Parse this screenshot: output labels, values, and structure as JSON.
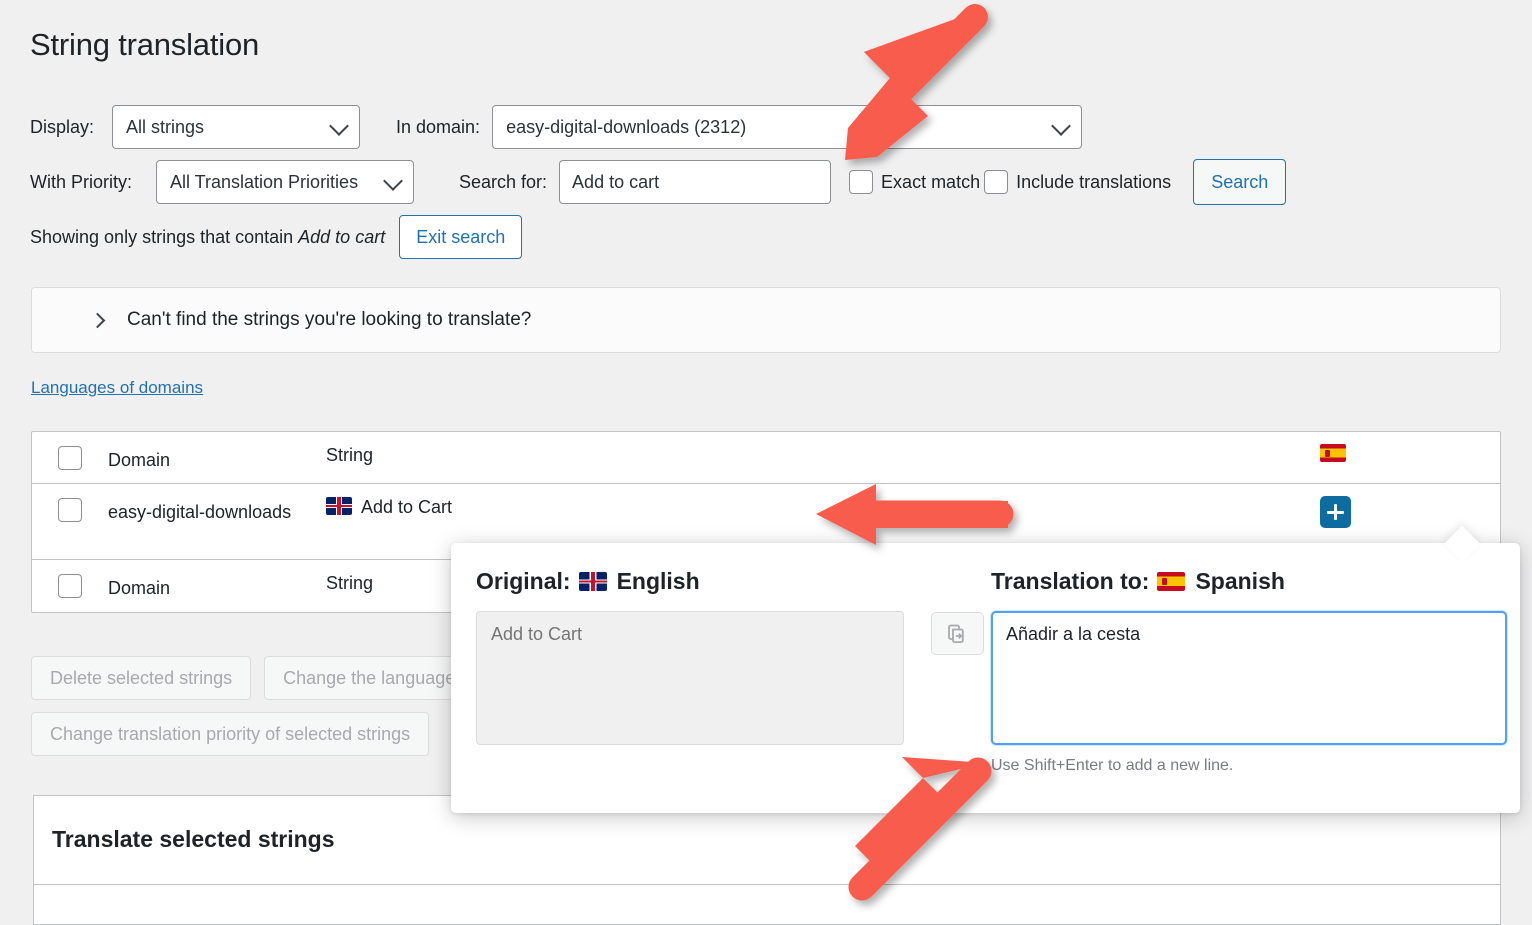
{
  "page": {
    "title": "String translation"
  },
  "filters": {
    "display_label": "Display:",
    "display_value": "All strings",
    "domain_label": "In domain:",
    "domain_value": "easy-digital-downloads (2312)",
    "priority_label": "With Priority:",
    "priority_value": "All Translation Priorities",
    "search_label": "Search for:",
    "search_value": "Add to cart",
    "search_placeholder": "Search for:",
    "exact_match_label": "Exact match",
    "include_translations_label": "Include translations",
    "search_button": "Search"
  },
  "showing": {
    "prefix": "Showing only strings that contain ",
    "term": "Add to cart",
    "exit_button": "Exit search"
  },
  "accordion": {
    "label": "Can't find the strings you're looking to translate?",
    "icon": "chevron-right-icon"
  },
  "languages_link": "Languages of domains",
  "table": {
    "headers": {
      "domain": "Domain",
      "string": "String",
      "language_flag": "spain-flag-icon"
    },
    "rows": [
      {
        "domain": "easy-digital-downloads",
        "string": "Add to Cart",
        "string_flag": "uk-flag-icon",
        "action": "add-translation-icon"
      }
    ],
    "footer_headers": {
      "domain": "Domain",
      "string": "String"
    }
  },
  "bulk_actions": {
    "delete": "Delete selected strings",
    "change_language": "Change the language of selected strings",
    "change_priority": "Change translation priority of selected strings"
  },
  "translate_panel": {
    "title": "Translate selected strings"
  },
  "popup": {
    "original_label": "Original:",
    "original_language": "English",
    "original_flag": "uk-flag-icon",
    "original_placeholder": "Add to Cart",
    "copy_icon": "copy-to-icon",
    "translation_label": "Translation to:",
    "translation_language": "Spanish",
    "translation_flag": "spain-flag-icon",
    "translation_value": "Añadir a la cesta",
    "hint": "Use Shift+Enter to add a new line."
  },
  "colors": {
    "accent_blue": "#2271b1",
    "plus_button_blue": "#0e6ca1",
    "arrow_red": "#f85c4e",
    "focus_blue": "#4fa2f3",
    "page_bg": "#f0f0f1"
  },
  "annotations": [
    {
      "name": "arrow-to-search-field",
      "direction": "down-left"
    },
    {
      "name": "arrow-to-add-translation-button",
      "direction": "left"
    },
    {
      "name": "arrow-to-translation-textarea",
      "direction": "up-right"
    }
  ]
}
